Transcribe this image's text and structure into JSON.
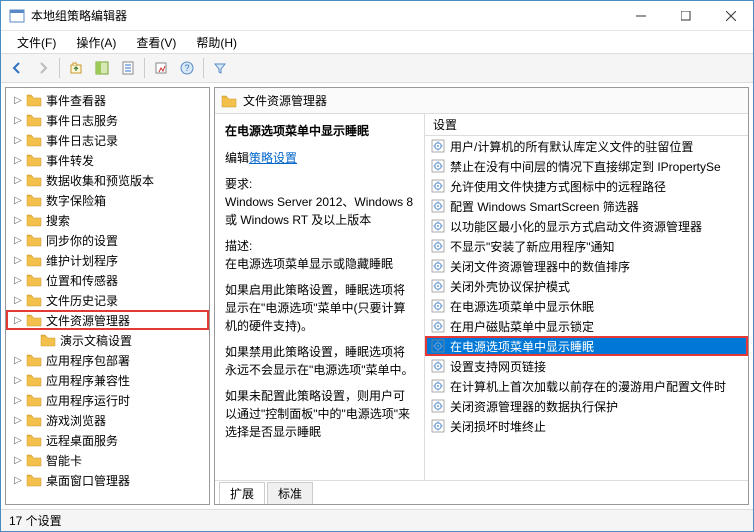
{
  "window": {
    "title": "本地组策略编辑器"
  },
  "menu": {
    "file": "文件(F)",
    "action": "操作(A)",
    "view": "查看(V)",
    "help": "帮助(H)"
  },
  "tree": {
    "items": [
      {
        "label": "事件查看器"
      },
      {
        "label": "事件日志服务"
      },
      {
        "label": "事件日志记录"
      },
      {
        "label": "事件转发"
      },
      {
        "label": "数据收集和预览版本"
      },
      {
        "label": "数字保险箱"
      },
      {
        "label": "搜索"
      },
      {
        "label": "同步你的设置"
      },
      {
        "label": "维护计划程序"
      },
      {
        "label": "位置和传感器"
      },
      {
        "label": "文件历史记录"
      },
      {
        "label": "文件资源管理器",
        "selected": true
      },
      {
        "label": "演示文稿设置",
        "indent": true
      },
      {
        "label": "应用程序包部署"
      },
      {
        "label": "应用程序兼容性"
      },
      {
        "label": "应用程序运行时"
      },
      {
        "label": "游戏浏览器"
      },
      {
        "label": "远程桌面服务"
      },
      {
        "label": "智能卡"
      },
      {
        "label": "桌面窗口管理器"
      }
    ]
  },
  "header": {
    "title": "文件资源管理器"
  },
  "desc": {
    "heading": "在电源选项菜单中显示睡眠",
    "edit_label": "编辑",
    "edit_link": "策略设置",
    "req_label": "要求:",
    "req_text": "Windows Server 2012、Windows 8 或 Windows RT 及以上版本",
    "desc_label": "描述:",
    "desc1": "在电源选项菜单显示或隐藏睡眠",
    "desc2": "如果启用此策略设置，睡眠选项将显示在\"电源选项\"菜单中(只要计算机的硬件支持)。",
    "desc3": "如果禁用此策略设置，睡眠选项将永远不会显示在\"电源选项\"菜单中。",
    "desc4": "如果未配置此策略设置，则用户可以通过\"控制面板\"中的\"电源选项\"来选择是否显示睡眠"
  },
  "list": {
    "header": "设置",
    "items": [
      "用户/计算机的所有默认库定义文件的驻留位置",
      "禁止在没有中间层的情况下直接绑定到 IPropertySe",
      "允许使用文件快捷方式图标中的远程路径",
      "配置 Windows SmartScreen 筛选器",
      "以功能区最小化的显示方式启动文件资源管理器",
      "不显示\"安装了新应用程序\"通知",
      "关闭文件资源管理器中的数值排序",
      "关闭外壳协议保护模式",
      "在电源选项菜单中显示休眠",
      "在用户磁贴菜单中显示锁定",
      "在电源选项菜单中显示睡眠",
      "设置支持网页链接",
      "在计算机上首次加载以前存在的漫游用户配置文件时",
      "关闭资源管理器的数据执行保护",
      "关闭损坏时堆终止"
    ],
    "selected_index": 10
  },
  "tabs": {
    "extended": "扩展",
    "standard": "标准"
  },
  "status": {
    "text": "17 个设置"
  }
}
